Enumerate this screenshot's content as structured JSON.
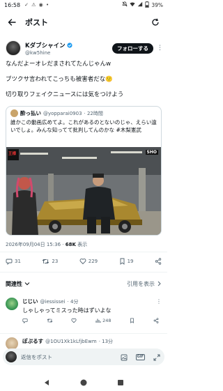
{
  "status_bar": {
    "time": "16:58",
    "notif_icons": "✓ ⚠ ◉ •",
    "battery": "39%"
  },
  "header": {
    "title": "ポスト"
  },
  "post": {
    "author_name": "Kダブシャイン",
    "author_handle": "@kw5hine",
    "follow_label": "フォローする",
    "lines": [
      "なんだよーオレだまされてたんじゃんw",
      "ブツクサ言われてこっちも被害者だな🙂",
      "切り取りフェイクニュースには気をつけよう"
    ],
    "quote": {
      "name": "酔っ払い",
      "handle": "@yopparai0903",
      "time": "· 22時間",
      "text": "誰かこの動画広めてよ。これがあるのとないのじゃ、えらい違いでしょ。みんな知ってて批判してんのかな #木梨憲武",
      "image_logo_left": "王様",
      "image_logo_right": "SHO"
    },
    "datetime": "2026年09月04日 15:36",
    "views_count": "68K",
    "views_label": "表示",
    "replies": "31",
    "reposts": "23",
    "likes": "229",
    "bookmarks": "19"
  },
  "related": {
    "label": "関連性",
    "quotes_label": "引用を表示"
  },
  "replies_list": [
    {
      "name": "じじい",
      "handle": "@iessissei",
      "time": "· 4分",
      "text": "しゃしゃってミスった時はずいよな",
      "views": "248",
      "avatar_color": "#2f8f4e"
    },
    {
      "name": "ぽぷるす",
      "handle": "@1OU1Xk1kLfjbEwm",
      "time": "· 13分",
      "text": "",
      "views": "",
      "avatar_color": "#c4a680"
    }
  ],
  "compose": {
    "placeholder": "返信をポスト"
  },
  "colors": {
    "accent": "#1d9bf0",
    "text": "#0f1419",
    "muted": "#536471",
    "pill": "#eff3f4"
  }
}
